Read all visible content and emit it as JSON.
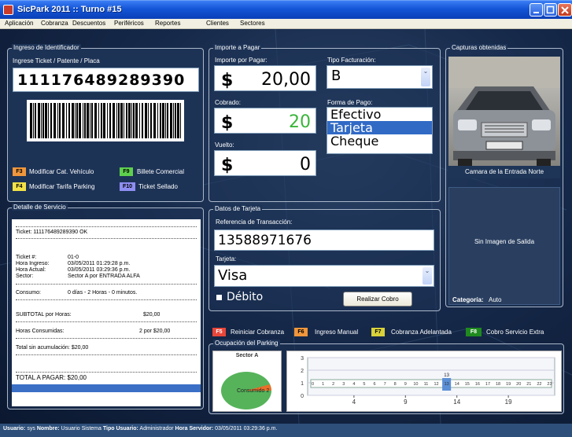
{
  "window": {
    "title": "SicPark 2011 :: Turno #15"
  },
  "menu": [
    "Aplicación",
    "Cobranza",
    "Descuentos",
    "Periféricos",
    "Reportes",
    "Clientes",
    "Sectores"
  ],
  "ingreso": {
    "legend": "Ingreso de Identificador",
    "label": "Ingrese Ticket / Patente / Placa",
    "value": "111176489289390",
    "keys": [
      {
        "key": "F3",
        "label": "Modificar Cat. Vehículo",
        "color": "#f0963c"
      },
      {
        "key": "F9",
        "label": "Billete Comercial",
        "color": "#5fd04e"
      },
      {
        "key": "F4",
        "label": "Modificar Tarifa Parking",
        "color": "#f2e247"
      },
      {
        "key": "F10",
        "label": "Ticket Sellado",
        "color": "#8e8ef2"
      }
    ]
  },
  "importe": {
    "legend": "Importe a Pagar",
    "importe_label": "Importe por Pagar:",
    "importe_cur": "$",
    "importe_value": "20,00",
    "cobrado_label": "Cobrado:",
    "cobrado_cur": "$",
    "cobrado_value": "20",
    "vuelto_label": "Vuelto:",
    "vuelto_cur": "$",
    "vuelto_value": "0",
    "tipo_label": "Tipo Facturación:",
    "tipo_value": "B",
    "forma_label": "Forma de Pago:",
    "formas": [
      "Efectivo",
      "Tarjeta",
      "Cheque"
    ],
    "forma_selected": 1
  },
  "capturas": {
    "legend": "Capturas obtenidas",
    "entrada_caption": "Camara de la Entrada Norte",
    "salida_text": "Sin Imagen de Salida",
    "categoria_label": "Categoría:",
    "categoria_value": "Auto"
  },
  "detalle": {
    "legend": "Detalle de Servicio",
    "ticket_line": "Ticket: 111176489289390 OK",
    "rows": [
      {
        "k": "Ticket #:",
        "v": "01-0"
      },
      {
        "k": "Hora Ingreso:",
        "v": "03/05/2011 01:29:28 p.m."
      },
      {
        "k": "Hora Actual:",
        "v": "03/05/2011 03:29:36 p.m."
      },
      {
        "k": "Sector:",
        "v": "Sector A por ENTRADA ALFA"
      }
    ],
    "consumo_label": "Consumo:",
    "consumo_value": "0 días - 2 Horas - 0 minutos.",
    "subtotal_label": "SUBTOTAL por Horas:",
    "subtotal_value": "$20,00",
    "horas_label": "Horas Consumidas:",
    "horas_value": "2 por $20,00",
    "total_sin": "Total sin acumulación: $20,00",
    "total_pagar": "TOTAL A PAGAR: $20,00"
  },
  "tarjeta": {
    "legend": "Datos de Tarjeta",
    "ref_label": "Referencia de Transacción:",
    "ref_value": "13588971676",
    "tarjeta_label": "Tarjeta:",
    "tarjeta_value": "Visa",
    "debito_label": "Débito",
    "cobro_button": "Realizar Cobro"
  },
  "fkeys": [
    {
      "key": "F5",
      "label": "Reiniciar Cobranza",
      "color": "#e8463a"
    },
    {
      "key": "F6",
      "label": "Ingreso Manual",
      "color": "#f0963c"
    },
    {
      "key": "F7",
      "label": "Cobranza Adelantada",
      "color": "#d9d23a"
    },
    {
      "key": "F8",
      "label": "Cobro Servicio Extra",
      "color": "#1f8a1f"
    }
  ],
  "ocupacion": {
    "legend": "Ocupación del Parking",
    "pie_title": "Sector A",
    "pie_label": "Consumido 2"
  },
  "chart_data": {
    "type": "bar",
    "x": [
      0,
      1,
      2,
      3,
      4,
      5,
      6,
      7,
      8,
      9,
      10,
      11,
      12,
      13,
      14,
      15,
      16,
      17,
      18,
      19,
      20,
      21,
      22,
      23
    ],
    "values": [
      0,
      0,
      0,
      0,
      0,
      0,
      0,
      0,
      0,
      0,
      0,
      0,
      0,
      1,
      0,
      0,
      0,
      0,
      0,
      0,
      0,
      0,
      0,
      0
    ],
    "data_labels": [
      {
        "x": 13,
        "text": "13"
      }
    ],
    "bottom_ticks": [
      "4",
      "9",
      "14",
      "19"
    ],
    "y_ticks": [
      "0",
      "1",
      "2",
      "3"
    ],
    "ylim": [
      0,
      3
    ],
    "bar_color": "#5b8fd6",
    "grid": true
  },
  "status": {
    "usuario_label": "Usuario:",
    "usuario_value": "sys",
    "nombre_label": "Nombre:",
    "nombre_value": "Usuario Sistema",
    "tipo_label": "Tipo Usuario:",
    "tipo_value": "Administrador",
    "hora_label": "Hora Servidor:",
    "hora_value": "03/05/2011 03:29:36 p.m."
  }
}
